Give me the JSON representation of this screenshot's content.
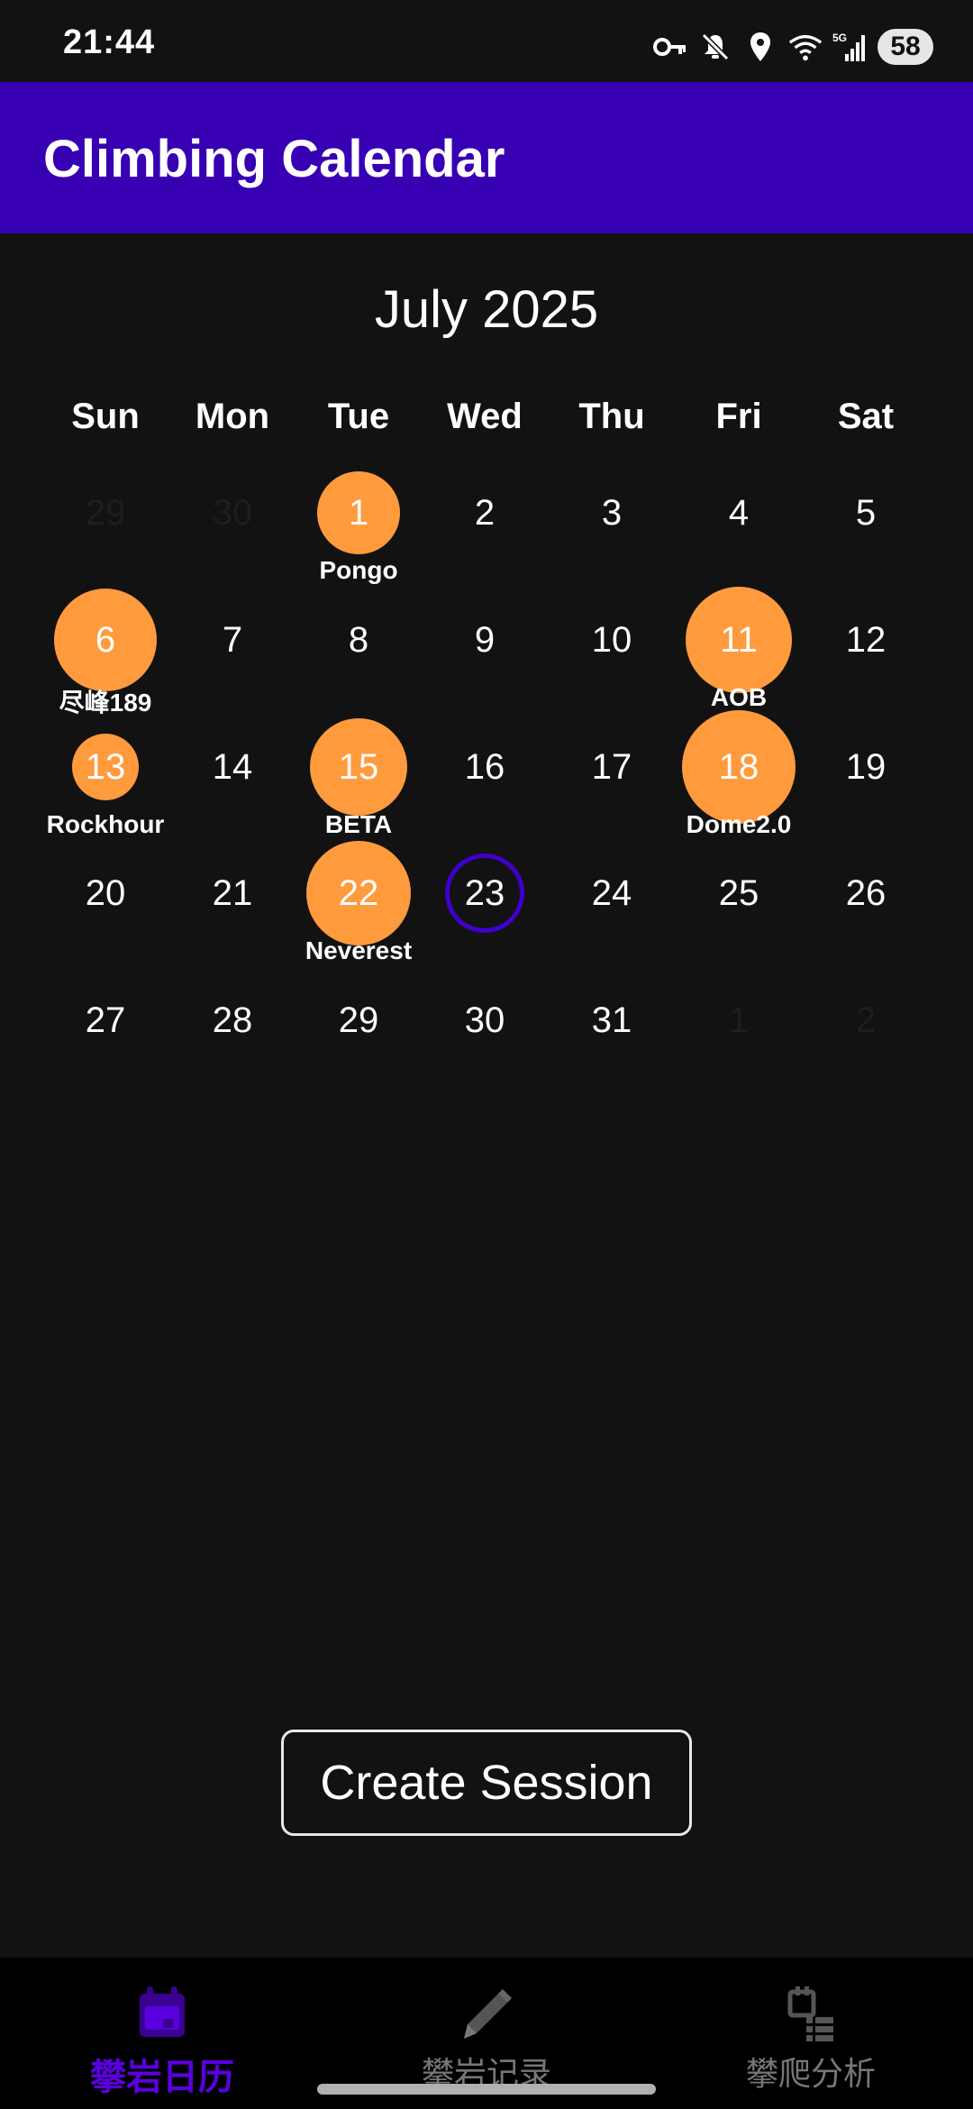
{
  "status_bar": {
    "time": "21:44",
    "battery": "58",
    "icons": [
      "key-icon",
      "mute-icon",
      "location-icon",
      "wifi-icon",
      "signal-5g-icon",
      "battery-icon"
    ]
  },
  "app_bar": {
    "title": "Climbing Calendar",
    "color": "#3700b3"
  },
  "calendar": {
    "month_title": "July 2025",
    "weekdays": [
      "Sun",
      "Mon",
      "Tue",
      "Wed",
      "Thu",
      "Fri",
      "Sat"
    ],
    "weeks": [
      [
        {
          "day": "29",
          "other": true
        },
        {
          "day": "30",
          "other": true
        },
        {
          "day": "1",
          "session": "Pongo"
        },
        {
          "day": "2"
        },
        {
          "day": "3"
        },
        {
          "day": "4"
        },
        {
          "day": "5"
        }
      ],
      [
        {
          "day": "6",
          "session": "尽峰189"
        },
        {
          "day": "7"
        },
        {
          "day": "8"
        },
        {
          "day": "9"
        },
        {
          "day": "10"
        },
        {
          "day": "11",
          "session": "AOB"
        },
        {
          "day": "12"
        }
      ],
      [
        {
          "day": "13",
          "session": "Rockhour"
        },
        {
          "day": "14"
        },
        {
          "day": "15",
          "session": "BETA"
        },
        {
          "day": "16"
        },
        {
          "day": "17"
        },
        {
          "day": "18",
          "session": "Dome2.0"
        },
        {
          "day": "19"
        }
      ],
      [
        {
          "day": "20"
        },
        {
          "day": "21"
        },
        {
          "day": "22",
          "session": "Neverest"
        },
        {
          "day": "23",
          "today": true
        },
        {
          "day": "24"
        },
        {
          "day": "25"
        },
        {
          "day": "26"
        }
      ],
      [
        {
          "day": "27"
        },
        {
          "day": "28"
        },
        {
          "day": "29"
        },
        {
          "day": "30"
        },
        {
          "day": "31"
        },
        {
          "day": "1",
          "other": true
        },
        {
          "day": "2",
          "other": true
        }
      ]
    ],
    "session_color": "#ff9a3d",
    "today_ring_color": "#3f00cc"
  },
  "actions": {
    "create_session_label": "Create Session"
  },
  "bottom_nav": {
    "items": [
      {
        "label": "攀岩日历",
        "icon": "calendar-icon",
        "active": true
      },
      {
        "label": "攀岩记录",
        "icon": "pencil-icon",
        "active": false
      },
      {
        "label": "攀爬分析",
        "icon": "analysis-icon",
        "active": false
      }
    ],
    "active_color": "#5a00e0"
  }
}
